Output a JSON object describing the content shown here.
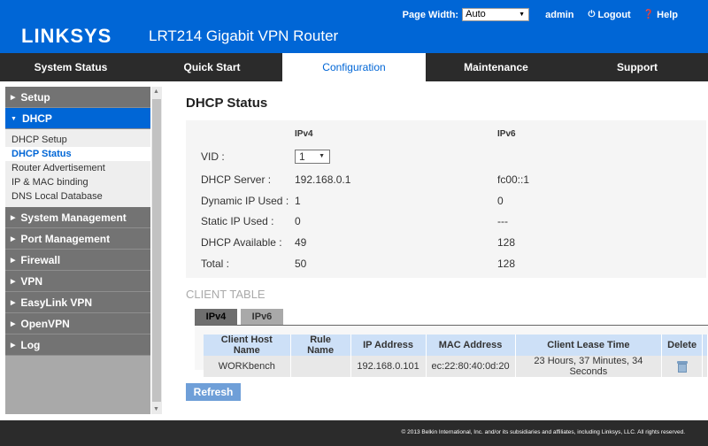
{
  "header": {
    "logo": "LINKSYS",
    "model": "LRT214  Gigabit VPN Router",
    "page_width_label": "Page Width:",
    "page_width_value": "Auto",
    "user": "admin",
    "logout": "Logout",
    "help": "Help"
  },
  "nav": {
    "tabs": [
      {
        "label": "System Status"
      },
      {
        "label": "Quick Start"
      },
      {
        "label": "Configuration",
        "active": true
      },
      {
        "label": "Maintenance"
      },
      {
        "label": "Support"
      }
    ]
  },
  "sidebar": {
    "setup": "Setup",
    "dhcp": "DHCP",
    "dhcp_items": [
      "DHCP Setup",
      "DHCP Status",
      "Router Advertisement",
      "IP & MAC binding",
      "DNS Local Database"
    ],
    "active_item": "DHCP Status",
    "categories": [
      "System Management",
      "Port Management",
      "Firewall",
      "VPN",
      "EasyLink VPN",
      "OpenVPN",
      "Log"
    ]
  },
  "main": {
    "title": "DHCP Status",
    "status": {
      "col_ipv4": "IPv4",
      "col_ipv6": "IPv6",
      "vid_label": "VID :",
      "vid_value": "1",
      "rows": [
        {
          "label": "DHCP Server :",
          "ipv4": "192.168.0.1",
          "ipv6": "fc00::1"
        },
        {
          "label": "Dynamic IP Used :",
          "ipv4": "1",
          "ipv6": "0"
        },
        {
          "label": "Static IP Used :",
          "ipv4": "0",
          "ipv6": "---"
        },
        {
          "label": "DHCP Available :",
          "ipv4": "49",
          "ipv6": "128"
        },
        {
          "label": "Total :",
          "ipv4": "50",
          "ipv6": "128"
        }
      ]
    },
    "client_table": {
      "title": "CLIENT TABLE",
      "tabs": [
        "IPv4",
        "IPv6"
      ],
      "active_tab": "IPv4",
      "columns": [
        "Client Host Name",
        "Rule Name",
        "IP Address",
        "MAC Address",
        "Client Lease Time",
        "Delete"
      ],
      "rows": [
        {
          "host": "WORKbench",
          "rule": "",
          "ip": "192.168.0.101",
          "mac": "ec:22:80:40:0d:20",
          "lease": "23 Hours, 37 Minutes, 34 Seconds"
        }
      ]
    },
    "refresh": "Refresh"
  },
  "footer": {
    "copyright": "© 2013 Belkin International, Inc. and/or its subsidiaries and affiliates, including Linksys, LLC. All rights reserved."
  },
  "colors": {
    "brand_blue": "#0066d6",
    "nav_dark": "#2b2b2b",
    "sidebar_gray": "#737373"
  }
}
